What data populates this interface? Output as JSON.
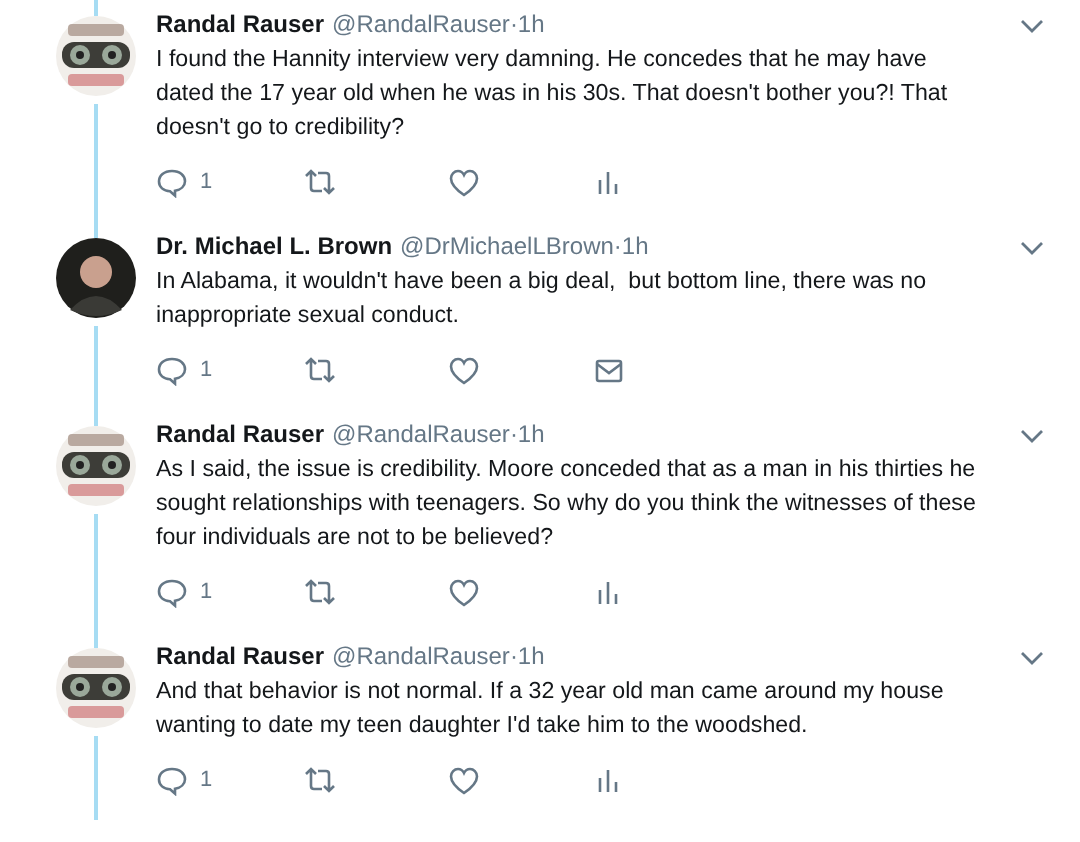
{
  "tweets": [
    {
      "name": "Randal Rauser",
      "handle": "@RandalRauser",
      "time": "·1h",
      "avatar": {
        "kind": "logo"
      },
      "text": "I found the Hannity interview very damning. He concedes that he may have\ndated the 17 year old when he was in his 30s. That doesn't bother you?! That\ndoesn't go to credibility?",
      "replies": "1",
      "extra_action": {
        "kind": "analytics"
      }
    },
    {
      "name": "Dr. Michael L. Brown",
      "handle": "@DrMichaelLBrown",
      "time": "·1h",
      "avatar": {
        "kind": "person"
      },
      "text": "In Alabama, it wouldn't have been a big deal,  but bottom line, there was no\ninappropriate sexual conduct.",
      "replies": "1",
      "extra_action": {
        "kind": "message"
      }
    },
    {
      "name": "Randal Rauser",
      "handle": "@RandalRauser",
      "time": "·1h",
      "avatar": {
        "kind": "logo"
      },
      "text": "As I said, the issue is credibility. Moore conceded that as a man in his thirties he\nsought relationships with teenagers. So why do you think the witnesses of these\nfour individuals are not to be believed?",
      "replies": "1",
      "extra_action": {
        "kind": "analytics"
      }
    },
    {
      "name": "Randal Rauser",
      "handle": "@RandalRauser",
      "time": "·1h",
      "avatar": {
        "kind": "logo"
      },
      "text": "And that behavior is not normal. If a 32 year old man came around my house\nwanting to date my teen daughter I'd take him to the woodshed.",
      "replies": "1",
      "extra_action": {
        "kind": "analytics"
      }
    }
  ]
}
